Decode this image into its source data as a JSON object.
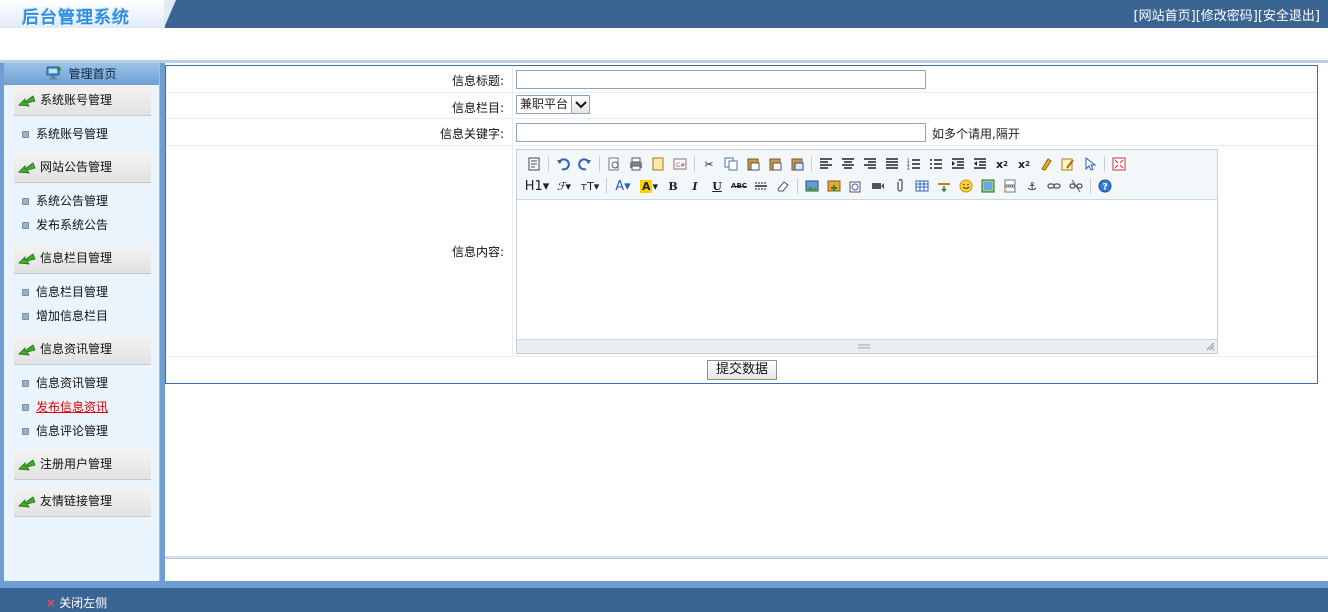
{
  "header": {
    "logo": "后台管理系统",
    "links": [
      {
        "label": "[网站首页]"
      },
      {
        "label": "[修改密码]"
      },
      {
        "label": "[安全退出]"
      }
    ]
  },
  "sidebar": {
    "home": "管理首页",
    "groups": [
      {
        "title": "系统账号管理",
        "items": [
          "系统账号管理"
        ]
      },
      {
        "title": "网站公告管理",
        "items": [
          "系统公告管理",
          "发布系统公告"
        ]
      },
      {
        "title": "信息栏目管理",
        "items": [
          "信息栏目管理",
          "增加信息栏目"
        ]
      },
      {
        "title": "信息资讯管理",
        "items": [
          "信息资讯管理",
          "发布信息资讯",
          "信息评论管理"
        ]
      },
      {
        "title": "注册用户管理",
        "items": []
      },
      {
        "title": "友情链接管理",
        "items": []
      }
    ],
    "active_item": "发布信息资讯"
  },
  "form": {
    "title_label": "信息标题:",
    "title_value": "",
    "column_label": "信息栏目:",
    "column_selected": "兼职平台",
    "keyword_label": "信息关键字:",
    "keyword_value": "",
    "keyword_hint": "如多个请用,隔开",
    "content_label": "信息内容:",
    "submit_label": "提交数据"
  },
  "editor_toolbar": {
    "row1": [
      "source-icon",
      "undo-icon",
      "redo-icon",
      "preview-icon",
      "print-icon",
      "template-icon",
      "code-icon",
      "cut-icon",
      "copy-icon",
      "paste-icon",
      "paste-plain-icon",
      "paste-word-icon",
      "align-left-icon",
      "align-center-icon",
      "align-right-icon",
      "align-justify-icon",
      "ordered-list-icon",
      "unordered-list-icon",
      "indent-icon",
      "outdent-icon",
      "subscript-icon",
      "superscript-icon",
      "clear-format-icon",
      "select-all-icon",
      "cursor-icon",
      "fullscreen-icon"
    ],
    "row2_text": {
      "heading": "H1",
      "bold": "B",
      "italic": "I",
      "underline": "U",
      "strike": "ABC"
    }
  },
  "footer": {
    "close_left": "关闭左侧"
  },
  "colors": {
    "header_bg": "#3a6491",
    "sidebar_bg": "#6f9fd2",
    "active_link": "#e00000",
    "frame_border": "#3a6ea8"
  }
}
